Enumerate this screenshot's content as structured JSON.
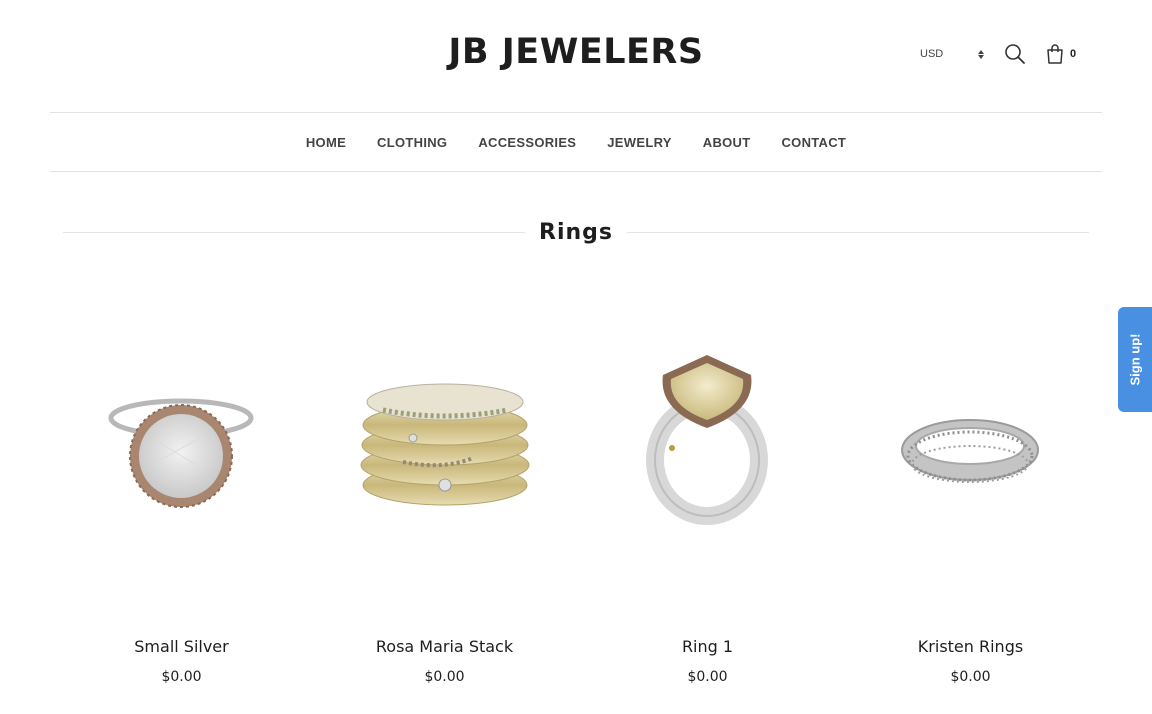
{
  "header": {
    "logo": "JB JEWELERS",
    "currency": "USD",
    "cart_count": "0"
  },
  "nav": {
    "items": [
      "HOME",
      "CLOTHING",
      "ACCESSORIES",
      "JEWELRY",
      "ABOUT",
      "CONTACT"
    ]
  },
  "collection": {
    "title": "Rings"
  },
  "products": [
    {
      "name": "Small Silver",
      "price": "$0.00"
    },
    {
      "name": "Rosa Maria Stack",
      "price": "$0.00"
    },
    {
      "name": "Ring 1",
      "price": "$0.00"
    },
    {
      "name": "Kristen Rings",
      "price": "$0.00"
    }
  ],
  "signup": {
    "label": "Sign up!"
  },
  "colors": {
    "accent": "#4a90e2",
    "text": "#1e1e1e",
    "divider": "#e3e3e3"
  }
}
